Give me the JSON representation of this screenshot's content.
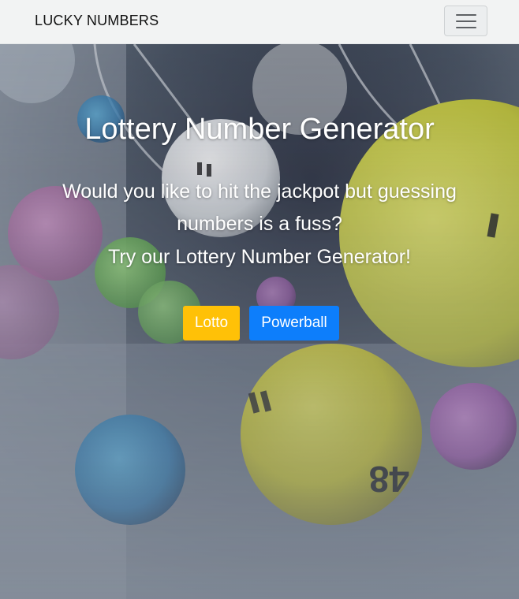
{
  "navbar": {
    "brand": "LUCKY NUMBERS",
    "toggler_icon": "hamburger-menu-icon"
  },
  "hero": {
    "title": "Lottery Number Generator",
    "subtitle_line1": "Would you like to hit the jackpot but guessing",
    "subtitle_line2": "numbers is a fuss?",
    "subtitle_line3": "Try our Lottery Number Generator!",
    "ball_number": "48",
    "buttons": {
      "lotto": "Lotto",
      "powerball": "Powerball"
    }
  },
  "colors": {
    "navbar_bg": "#f2f3f3",
    "lotto_button": "#ffc107",
    "powerball_button": "#0d7efb",
    "hero_text": "#ffffff"
  }
}
